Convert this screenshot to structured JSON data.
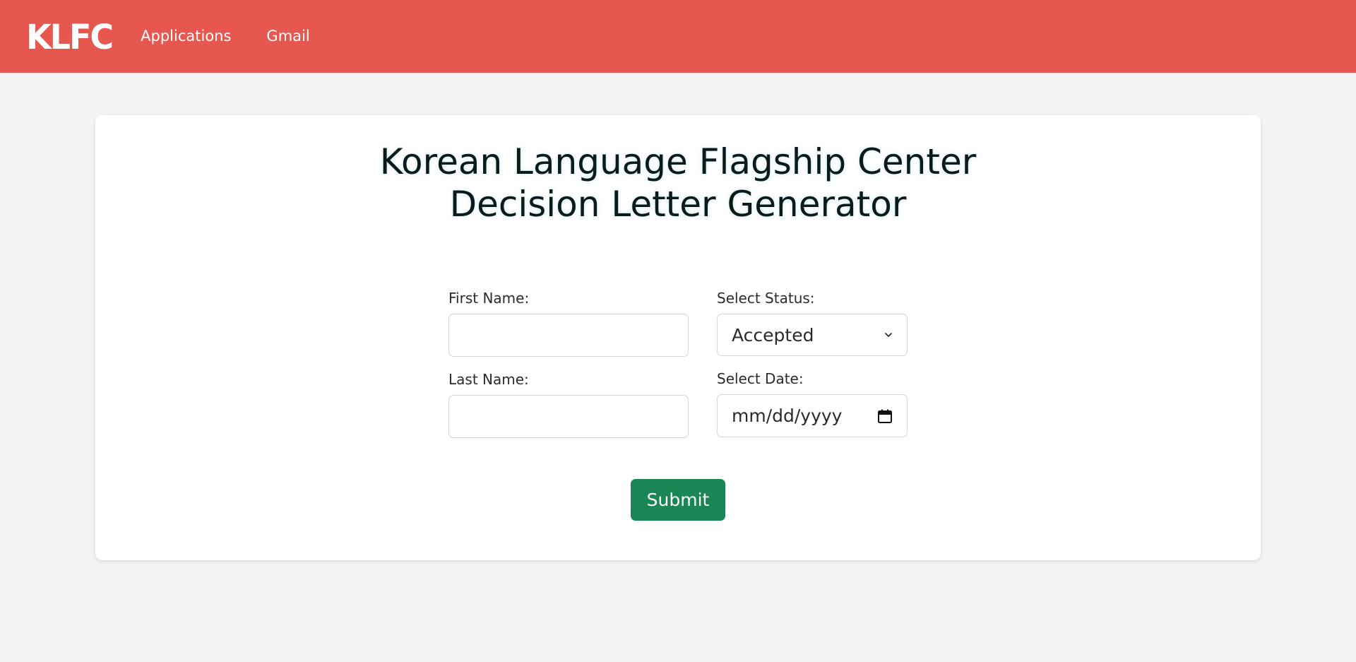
{
  "navbar": {
    "brand": "KLFC",
    "links": [
      {
        "label": "Applications"
      },
      {
        "label": "Gmail"
      }
    ],
    "background_color": "#e5574f"
  },
  "form": {
    "title_line1": "Korean Language Flagship Center",
    "title_line2": "Decision Letter Generator",
    "first_name": {
      "label": "First Name:",
      "value": ""
    },
    "last_name": {
      "label": "Last Name:",
      "value": ""
    },
    "status": {
      "label": "Select Status:",
      "selected": "Accepted",
      "icon": "chevron-down-icon"
    },
    "date": {
      "label": "Select Date:",
      "placeholder": "mm/dd/yyyy",
      "icon": "calendar-icon"
    },
    "submit_label": "Submit",
    "submit_color": "#1b8655"
  }
}
